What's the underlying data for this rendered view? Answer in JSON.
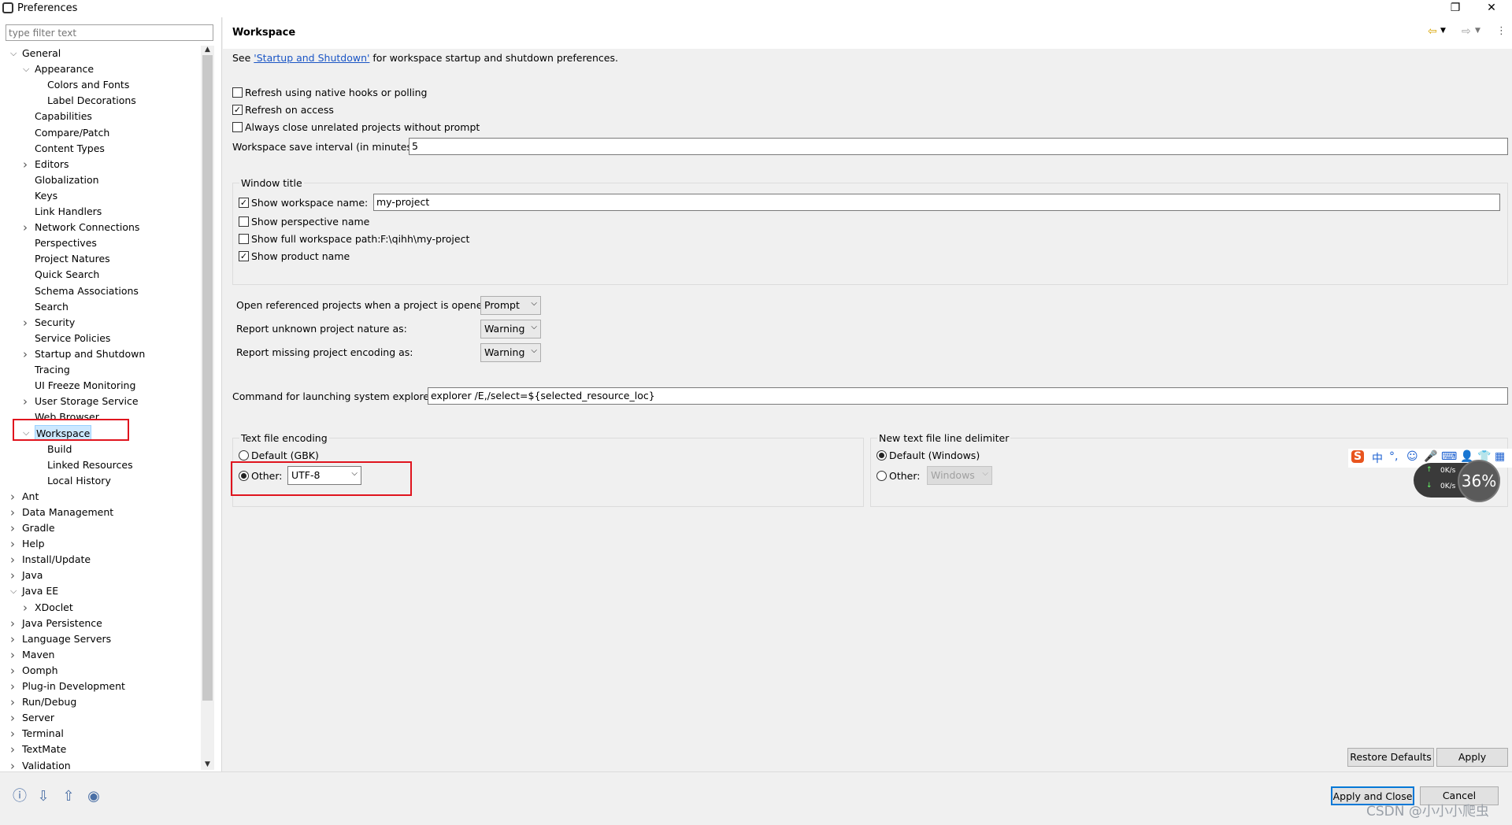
{
  "window": {
    "title": "Preferences",
    "restore": "❐",
    "close": "✕"
  },
  "filter": {
    "placeholder": "type filter text"
  },
  "tree": [
    {
      "label": "General",
      "twisty": "v"
    },
    {
      "label": "Appearance",
      "twisty": "v"
    },
    {
      "label": "Colors and Fonts",
      "twisty": ""
    },
    {
      "label": "Label Decorations",
      "twisty": ""
    },
    {
      "label": "Capabilities",
      "twisty": ""
    },
    {
      "label": "Compare/Patch",
      "twisty": ""
    },
    {
      "label": "Content Types",
      "twisty": ""
    },
    {
      "label": "Editors",
      "twisty": ">"
    },
    {
      "label": "Globalization",
      "twisty": ""
    },
    {
      "label": "Keys",
      "twisty": ""
    },
    {
      "label": "Link Handlers",
      "twisty": ""
    },
    {
      "label": "Network Connections",
      "twisty": ">"
    },
    {
      "label": "Perspectives",
      "twisty": ""
    },
    {
      "label": "Project Natures",
      "twisty": ""
    },
    {
      "label": "Quick Search",
      "twisty": ""
    },
    {
      "label": "Schema Associations",
      "twisty": ""
    },
    {
      "label": "Search",
      "twisty": ""
    },
    {
      "label": "Security",
      "twisty": ">"
    },
    {
      "label": "Service Policies",
      "twisty": ""
    },
    {
      "label": "Startup and Shutdown",
      "twisty": ">"
    },
    {
      "label": "Tracing",
      "twisty": ""
    },
    {
      "label": "UI Freeze Monitoring",
      "twisty": ""
    },
    {
      "label": "User Storage Service",
      "twisty": ">"
    },
    {
      "label": "Web Browser",
      "twisty": ""
    },
    {
      "label": "Workspace",
      "twisty": "v",
      "selected": true
    },
    {
      "label": "Build",
      "twisty": ""
    },
    {
      "label": "Linked Resources",
      "twisty": ""
    },
    {
      "label": "Local History",
      "twisty": ""
    },
    {
      "label": "Ant",
      "twisty": ">"
    },
    {
      "label": "Data Management",
      "twisty": ">"
    },
    {
      "label": "Gradle",
      "twisty": ">"
    },
    {
      "label": "Help",
      "twisty": ">"
    },
    {
      "label": "Install/Update",
      "twisty": ">"
    },
    {
      "label": "Java",
      "twisty": ">"
    },
    {
      "label": "Java EE",
      "twisty": "v"
    },
    {
      "label": "XDoclet",
      "twisty": ">"
    },
    {
      "label": "Java Persistence",
      "twisty": ">"
    },
    {
      "label": "Language Servers",
      "twisty": ">"
    },
    {
      "label": "Maven",
      "twisty": ">"
    },
    {
      "label": "Oomph",
      "twisty": ">"
    },
    {
      "label": "Plug-in Development",
      "twisty": ">"
    },
    {
      "label": "Run/Debug",
      "twisty": ">"
    },
    {
      "label": "Server",
      "twisty": ">"
    },
    {
      "label": "Terminal",
      "twisty": ">"
    },
    {
      "label": "TextMate",
      "twisty": ">"
    },
    {
      "label": "Validation",
      "twisty": ">"
    }
  ],
  "page": {
    "title": "Workspace",
    "see_prefix": "See ",
    "see_link": "'Startup and Shutdown'",
    "see_suffix": " for workspace startup and shutdown preferences.",
    "refresh_native": "Refresh using native hooks or polling",
    "refresh_native_checked": false,
    "refresh_access": "Refresh on access",
    "refresh_access_checked": true,
    "always_close": "Always close unrelated projects without prompt",
    "always_close_checked": false,
    "save_interval_label": "Workspace save interval (in minutes):",
    "save_interval_value": "5",
    "window_title": {
      "group": "Window title",
      "show_ws_name": "Show workspace name:",
      "show_ws_name_checked": true,
      "ws_name_value": "my-project",
      "show_perspective": "Show perspective name",
      "show_perspective_checked": false,
      "show_full_path": "Show full workspace path:",
      "show_full_path_checked": false,
      "full_path_value": "F:\\qihh\\my-project",
      "show_product": "Show product name",
      "show_product_checked": true
    },
    "open_ref_label": "Open referenced projects when a project is opened:",
    "open_ref_value": "Prompt",
    "unknown_nature_label": "Report unknown project nature as:",
    "unknown_nature_value": "Warning",
    "missing_encoding_label": "Report missing project encoding as:",
    "missing_encoding_value": "Warning",
    "explorer_label": "Command for launching system explorer:",
    "explorer_value": "explorer /E,/select=${selected_resource_loc}",
    "encoding": {
      "group": "Text file encoding",
      "default_label": "Default (GBK)",
      "other_label": "Other:",
      "other_selected": true,
      "other_value": "UTF-8"
    },
    "delimiter": {
      "group": "New text file line delimiter",
      "default_label": "Default (Windows)",
      "default_selected": true,
      "other_label": "Other:",
      "other_value": "Windows"
    },
    "restore_defaults": "Restore Defaults",
    "apply": "Apply"
  },
  "footer": {
    "apply_close": "Apply and Close",
    "cancel": "Cancel",
    "icons": [
      "help-icon",
      "import-icon",
      "export-icon",
      "oomph-icon"
    ]
  },
  "overlay": {
    "ime_chars": [
      "S",
      "中",
      "°,",
      "☺",
      "🎤",
      "⌨",
      "👤",
      "👕",
      "▦"
    ],
    "speed_up": "0K/s",
    "speed_down": "0K/s",
    "percent": "36%",
    "watermark": "CSDN @小小小爬虫"
  },
  "colors": {
    "link": "#1a55c5",
    "highlight_box": "#e0141e",
    "selection": "#cce8ff"
  }
}
